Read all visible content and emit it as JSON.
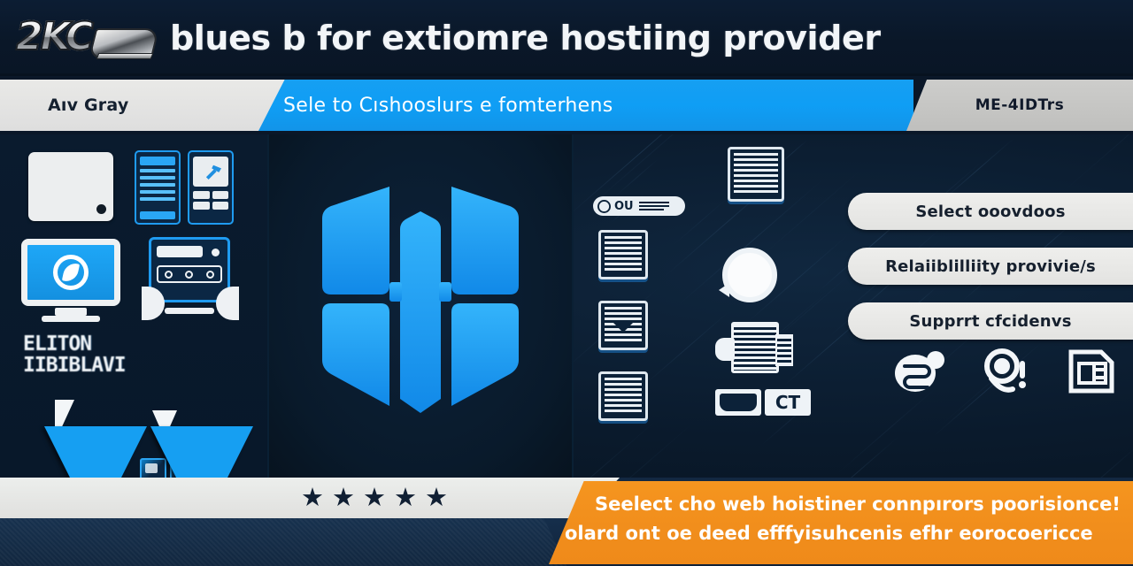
{
  "header": {
    "logo_text": "2KC",
    "logo_name": "brand-chrome-logo",
    "title": "blues b for extiomre hostiing provider"
  },
  "navbar": {
    "left_label": "Aıv Gray",
    "center_label": "Sele to Cıshooslurs e fomterhens",
    "right_label": "ME-4IDTrs"
  },
  "left_panel": {
    "glitch_line1": "ELITON",
    "glitch_line2": "IIBIBLAVI",
    "icons": [
      "blank-card-icon",
      "form-list-icon",
      "form-tools-icon",
      "monitor-logo-icon",
      "server-rack-icon",
      "mini-icon-grid",
      "down-arrow-icon",
      "down-arrow-icon"
    ]
  },
  "center_panel": {
    "logo_name": "hexagon-shield-logo",
    "accent": "#1fa2f5"
  },
  "right_panel": {
    "tag_label": "OU",
    "icons": [
      "document-icon",
      "document-icon",
      "document-download-icon",
      "document-icon",
      "document-large-icon",
      "refresh-icon",
      "printer-icon",
      "ct-badge-icon"
    ],
    "ct_label": "CT",
    "buttons": [
      {
        "label": "Select ooovdoos",
        "name": "select-ooovdoos-button"
      },
      {
        "label": "Relaiiblilliity provivie/s",
        "name": "reliability-providers-button"
      },
      {
        "label": "Supprrt cfcidenvs",
        "name": "support-clients-button"
      }
    ],
    "bottom_icons": [
      "support-chat-icon",
      "search-alert-icon",
      "file-list-icon"
    ]
  },
  "footer": {
    "rating_stars": 5,
    "star_glyph": "★",
    "banner_line1": "Seelect cho web hoistiner connpırors poorisionce!",
    "banner_line2": "olard ont oe deed efffyisuhcenis efhr eorocoericce"
  },
  "colors": {
    "accent_blue": "#169ff2",
    "orange": "#f2901c",
    "dark_navy": "#0a1728",
    "light_gray": "#e6e6e4"
  }
}
